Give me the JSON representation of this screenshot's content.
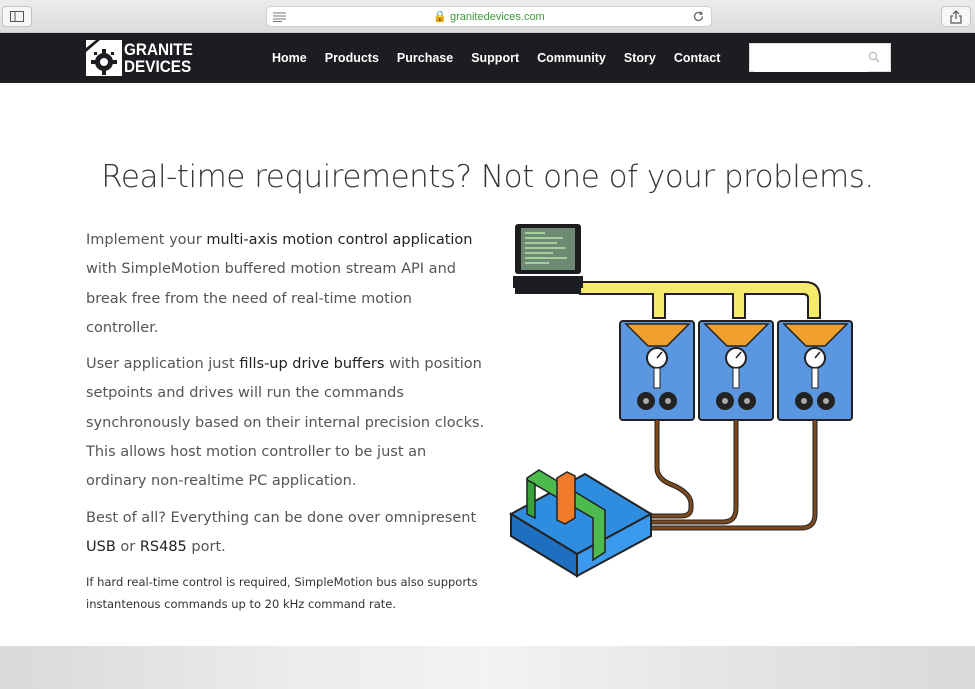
{
  "browser": {
    "url": "granitedevices.com"
  },
  "site": {
    "logo_line1": "GRANITE",
    "logo_line2": "DEVICES",
    "nav": [
      "Home",
      "Products",
      "Purchase",
      "Support",
      "Community",
      "Story",
      "Contact"
    ],
    "search_placeholder": ""
  },
  "main": {
    "headline": "Real-time requirements? Not one of your problems.",
    "p1": {
      "a": "Implement your ",
      "b": "multi-axis motion control application",
      "c": " with SimpleMotion buffered motion stream API and break free from the need of real-time motion controller."
    },
    "p2": {
      "a": "User application just ",
      "b": "fills-up drive buffers",
      "c": " with position setpoints and drives will run the commands synchronously based on their internal precision clocks. This allows host motion controller to be just an ordinary non-realtime PC application."
    },
    "p3": {
      "a": "Best of all? Everything can be done over omnipresent ",
      "b": "USB",
      "c": " or ",
      "d": "RS485",
      "e": " port."
    },
    "note": "If hard real-time control is required, SimpleMotion bus also supports instantenous commands up to 20 kHz command rate."
  },
  "colors": {
    "nav_bg": "#1c1d20",
    "cable_yellow": "#f5ea6b",
    "drive_blue": "#5a97e0",
    "buffer_orange": "#f0a02e",
    "wire_brown": "#7a4a1e"
  }
}
